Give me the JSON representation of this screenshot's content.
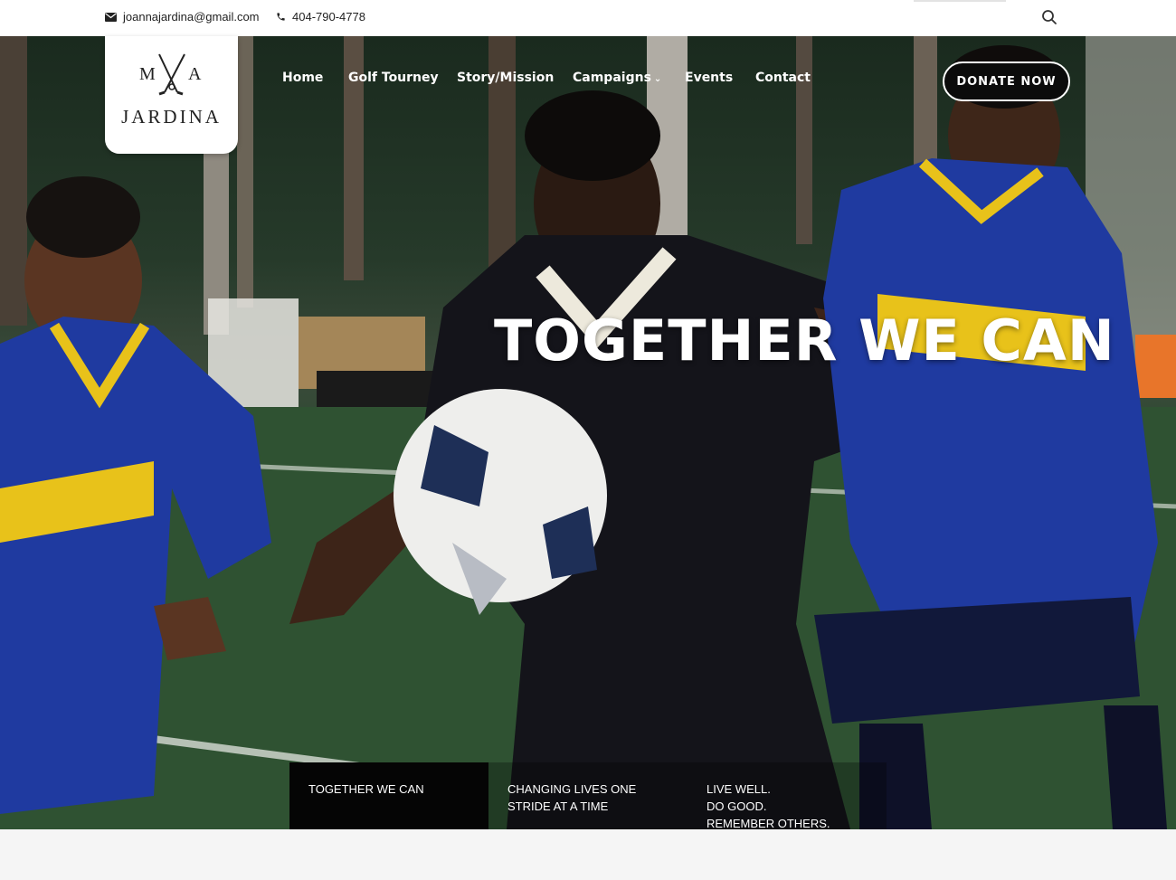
{
  "topbar": {
    "email": "joannajardina@gmail.com",
    "phone": "404-790-4778",
    "icons": {
      "email": "envelope-icon",
      "phone": "phone-icon",
      "search": "search-icon"
    }
  },
  "logo": {
    "text": "JARDINA",
    "letters": "M A"
  },
  "nav": {
    "items": [
      {
        "label": "Home"
      },
      {
        "label": "Golf Tourney"
      },
      {
        "label": "Story/Mission"
      },
      {
        "label": "Campaigns",
        "dropdown": true
      },
      {
        "label": "Events"
      },
      {
        "label": "Contact"
      }
    ],
    "donate_label": "DONATE NOW"
  },
  "hero": {
    "headline": "TOGETHER WE CAN",
    "tabs": [
      {
        "lines": [
          "TOGETHER WE CAN"
        ],
        "active": true
      },
      {
        "lines": [
          "CHANGING LIVES ONE",
          "STRIDE AT A TIME"
        ],
        "active": false
      },
      {
        "lines": [
          "LIVE WELL.",
          "DO GOOD.",
          "REMEMBER OTHERS."
        ],
        "active": false
      }
    ]
  },
  "colors": {
    "accent": "#000000",
    "text_light": "#ffffff",
    "jersey_blue": "#1f3aa0",
    "jersey_yellow": "#e8c21a"
  }
}
